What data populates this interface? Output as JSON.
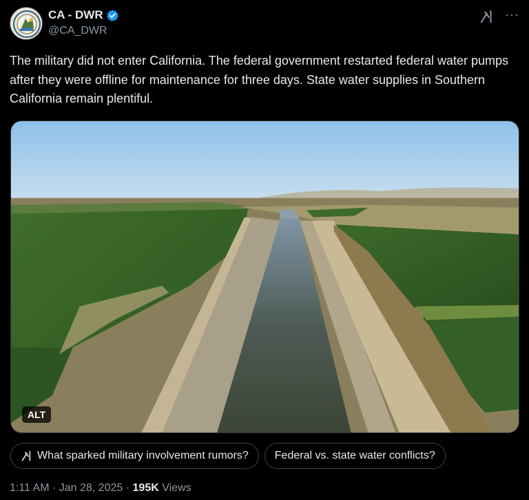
{
  "author": {
    "display_name": "CA - DWR",
    "handle": "@CA_DWR",
    "verified": true,
    "avatar_icon": "state-seal-icon"
  },
  "tweet": {
    "text": "The military did not enter California. The federal government restarted federal water pumps after they were offline for maintenance for three days. State water supplies in Southern California remain plentiful."
  },
  "media": {
    "alt_label": "ALT"
  },
  "chips": [
    {
      "label": "What sparked military involvement rumors?",
      "icon": "grok-icon"
    },
    {
      "label": "Federal vs. state water conflicts?"
    }
  ],
  "meta": {
    "time": "1:11 AM",
    "separator": "·",
    "date": "Jan 28, 2025",
    "views_count": "195K",
    "views_label": "Views"
  },
  "colors": {
    "background": "#000000",
    "text": "#e7e9ea",
    "secondary": "#8b98a5",
    "verified": "#1d9bf0"
  }
}
